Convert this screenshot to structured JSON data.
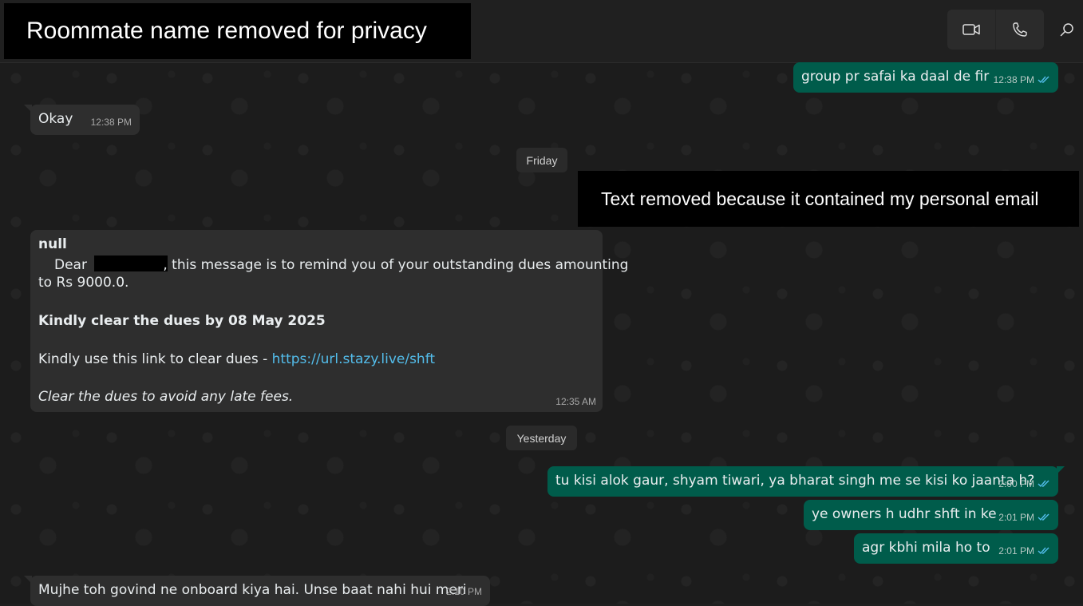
{
  "header": {
    "title_redaction_note": "Roommate name removed for privacy",
    "icons": [
      "video-call-icon",
      "voice-call-icon",
      "search-icon"
    ]
  },
  "redaction_note_email": "Text removed because it contained my personal email",
  "colors": {
    "outgoing": "#005c4b",
    "incoming": "#2e2e2e",
    "link": "#53bdeb",
    "read_ticks": "#53bdeb"
  },
  "messages": {
    "m1": {
      "text": "group pr safai ka daal de fir",
      "time": "12:38 PM"
    },
    "m2": {
      "text": "Okay",
      "time": "12:38 PM"
    },
    "date_friday": "Friday",
    "reminder": {
      "sender": "null",
      "line1_before": "Dear ",
      "line1_after": ", this message is to remind you of your outstanding dues amounting",
      "line2": "to Rs 9000.0.",
      "bold_line": "Kindly clear the dues by 08 May 2025",
      "link_prefix": "Kindly use this link to clear dues - ",
      "link": "https://url.stazy.live/shft",
      "italic_line": "Clear the dues to avoid any late fees.",
      "time": "12:35 AM"
    },
    "date_yesterday": "Yesterday",
    "m3": {
      "text": "tu kisi alok gaur, shyam tiwari, ya bharat singh me se kisi ko jaanta h?",
      "time": "2:00 PM"
    },
    "m4": {
      "text": "ye owners h udhr shft in ke",
      "time": "2:01 PM"
    },
    "m5": {
      "text": "agr kbhi mila ho to",
      "time": "2:01 PM"
    },
    "m6": {
      "text": "Mujhe toh govind ne onboard kiya hai. Unse baat nahi hui meri",
      "time": "2:10 PM"
    }
  }
}
